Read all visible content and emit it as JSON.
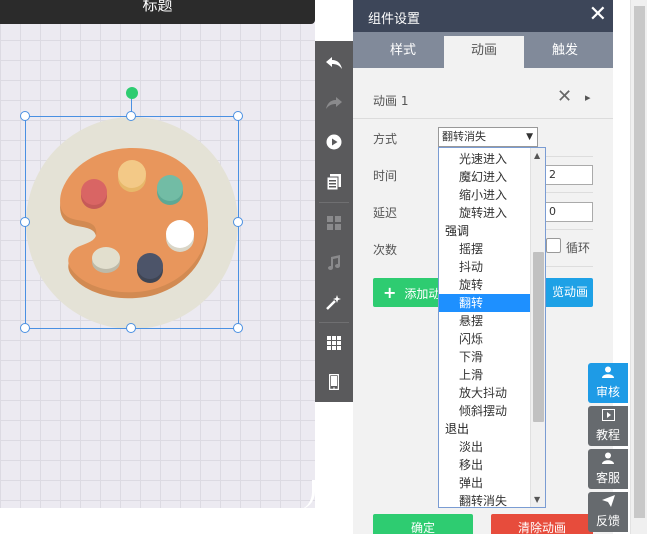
{
  "canvas": {
    "title": "标题"
  },
  "toolbar": {
    "items": [
      "undo-icon",
      "redo-icon",
      "play-icon",
      "pages-icon",
      "grid-icon",
      "music-icon",
      "magic-icon",
      "table-icon",
      "phone-icon"
    ]
  },
  "panel": {
    "title": "组件设置",
    "close": "✕",
    "tabs": [
      "样式",
      "动画",
      "触发"
    ],
    "active_tab": "动画",
    "animation_name": "动画 1",
    "mode_label": "方式",
    "mode_value": "翻转消失",
    "time_label": "时间",
    "time_value": "2",
    "delay_label": "延迟",
    "delay_value": "0",
    "count_label": "次数",
    "loop_label": "循环",
    "add_button": "添加动",
    "preview_button": "览动画",
    "confirm_button": "确定",
    "clear_button": "清除动画"
  },
  "dropdown": {
    "items": [
      {
        "label": "光速进入",
        "group": false,
        "selected": false
      },
      {
        "label": "魔幻进入",
        "group": false,
        "selected": false
      },
      {
        "label": "缩小进入",
        "group": false,
        "selected": false
      },
      {
        "label": "旋转进入",
        "group": false,
        "selected": false
      },
      {
        "label": "强调",
        "group": true,
        "selected": false
      },
      {
        "label": "摇摆",
        "group": false,
        "selected": false
      },
      {
        "label": "抖动",
        "group": false,
        "selected": false
      },
      {
        "label": "旋转",
        "group": false,
        "selected": false
      },
      {
        "label": "翻转",
        "group": false,
        "selected": true
      },
      {
        "label": "悬摆",
        "group": false,
        "selected": false
      },
      {
        "label": "闪烁",
        "group": false,
        "selected": false
      },
      {
        "label": "下滑",
        "group": false,
        "selected": false
      },
      {
        "label": "上滑",
        "group": false,
        "selected": false
      },
      {
        "label": "放大抖动",
        "group": false,
        "selected": false
      },
      {
        "label": "倾斜摆动",
        "group": false,
        "selected": false
      },
      {
        "label": "退出",
        "group": true,
        "selected": false
      },
      {
        "label": "淡出",
        "group": false,
        "selected": false
      },
      {
        "label": "移出",
        "group": false,
        "selected": false
      },
      {
        "label": "弹出",
        "group": false,
        "selected": false
      },
      {
        "label": "翻转消失",
        "group": false,
        "selected": false
      }
    ]
  },
  "side_buttons": [
    {
      "label": "审核",
      "icon": "user-icon",
      "color": "#1e9be6"
    },
    {
      "label": "教程",
      "icon": "video-icon",
      "color": "#666a6e"
    },
    {
      "label": "客服",
      "icon": "user-icon",
      "color": "#666a6e"
    },
    {
      "label": "反馈",
      "icon": "send-icon",
      "color": "#666a6e"
    }
  ],
  "colors": {
    "panel_header": "#3d4659",
    "tabs_bg": "#818a9a",
    "accent_green": "#2ecc71",
    "accent_blue": "#1ea1e6",
    "accent_red": "#e74c3c",
    "selection": "#4a90e2"
  }
}
